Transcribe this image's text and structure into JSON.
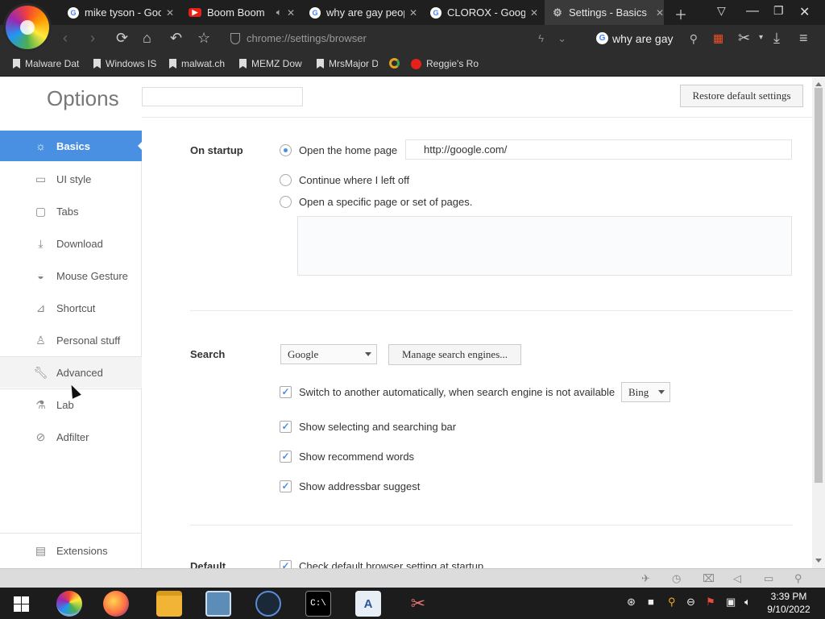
{
  "tabs": [
    {
      "title": "mike tyson - Goo",
      "favicon": "google"
    },
    {
      "title": "Boom Boom",
      "favicon": "youtube"
    },
    {
      "title": "why are gay peop",
      "favicon": "google"
    },
    {
      "title": "CLOROX - Googl",
      "favicon": "google"
    },
    {
      "title": "Settings - Basics",
      "favicon": "gear"
    }
  ],
  "address_bar": {
    "url": "chrome://settings/browser"
  },
  "search_box": {
    "query": "why are gay"
  },
  "bookmarks": [
    "Malware Dat",
    "Windows IS",
    "malwat.ch",
    "MEMZ Dow",
    "MrsMajor D",
    "",
    "Reggie's Ro"
  ],
  "options": {
    "title": "Options",
    "restore_label": "Restore default settings"
  },
  "sidebar": {
    "items": [
      {
        "label": "Basics",
        "icon": "gear-icon"
      },
      {
        "label": "UI style",
        "icon": "window-icon"
      },
      {
        "label": "Tabs",
        "icon": "tab-icon"
      },
      {
        "label": "Download",
        "icon": "download-icon"
      },
      {
        "label": "Mouse Gesture",
        "icon": "mouse-icon"
      },
      {
        "label": "Shortcut",
        "icon": "shortcut-icon"
      },
      {
        "label": "Personal stuff",
        "icon": "person-icon"
      },
      {
        "label": "Advanced",
        "icon": "wrench-icon"
      },
      {
        "label": "Lab",
        "icon": "flask-icon"
      },
      {
        "label": "Adfilter",
        "icon": "block-icon"
      }
    ],
    "extensions_label": "Extensions"
  },
  "startup": {
    "label": "On startup",
    "options": [
      "Open the home page",
      "Continue where I left off",
      "Open a specific page or set of pages."
    ],
    "selected_index": 0,
    "home_url": "http://google.com/"
  },
  "search": {
    "label": "Search",
    "engine": "Google",
    "manage_label": "Manage search engines...",
    "fallback_text": "Switch to another automatically, when search engine is not available",
    "fallback_engine": "Bing",
    "checks": [
      "Show selecting and searching bar",
      "Show recommend words",
      "Show addressbar suggest"
    ]
  },
  "default_section": {
    "label": "Default",
    "check": "Check default browser setting at startup"
  },
  "clock": {
    "time": "3:39 PM",
    "date": "9/10/2022"
  },
  "colors": {
    "accent": "#4a90e2",
    "tabbar": "#1f1f1f",
    "toolbar": "#2d2d2d"
  }
}
